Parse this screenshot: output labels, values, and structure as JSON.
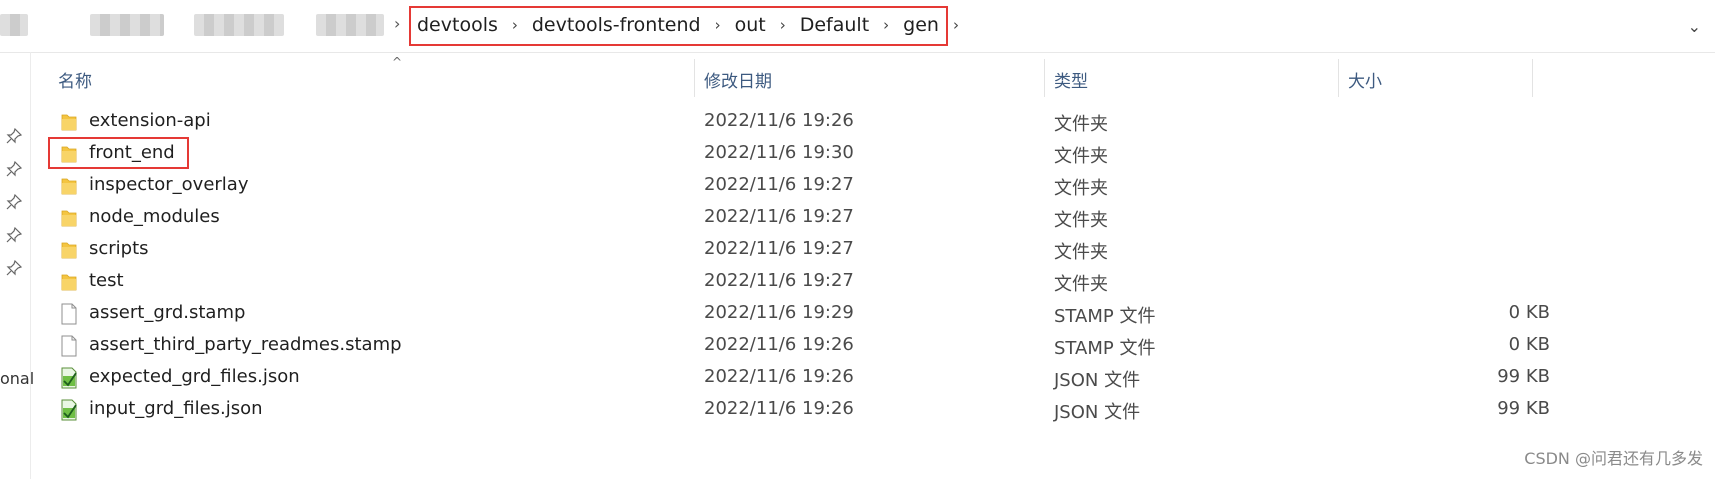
{
  "breadcrumb": {
    "items": [
      "devtools",
      "devtools-frontend",
      "out",
      "Default",
      "gen"
    ]
  },
  "columns": {
    "name": "名称",
    "date": "修改日期",
    "type": "类型",
    "size": "大小"
  },
  "nav_label": "onal",
  "files": [
    {
      "name": "extension-api",
      "date": "2022/11/6 19:26",
      "type": "文件夹",
      "size": "",
      "icon": "folder-icon"
    },
    {
      "name": "front_end",
      "date": "2022/11/6 19:30",
      "type": "文件夹",
      "size": "",
      "icon": "folder-icon"
    },
    {
      "name": "inspector_overlay",
      "date": "2022/11/6 19:27",
      "type": "文件夹",
      "size": "",
      "icon": "folder-icon"
    },
    {
      "name": "node_modules",
      "date": "2022/11/6 19:27",
      "type": "文件夹",
      "size": "",
      "icon": "folder-icon"
    },
    {
      "name": "scripts",
      "date": "2022/11/6 19:27",
      "type": "文件夹",
      "size": "",
      "icon": "folder-icon"
    },
    {
      "name": "test",
      "date": "2022/11/6 19:27",
      "type": "文件夹",
      "size": "",
      "icon": "folder-icon"
    },
    {
      "name": "assert_grd.stamp",
      "date": "2022/11/6 19:29",
      "type": "STAMP 文件",
      "size": "0 KB",
      "icon": "file-icon"
    },
    {
      "name": "assert_third_party_readmes.stamp",
      "date": "2022/11/6 19:26",
      "type": "STAMP 文件",
      "size": "0 KB",
      "icon": "file-icon"
    },
    {
      "name": "expected_grd_files.json",
      "date": "2022/11/6 19:26",
      "type": "JSON 文件",
      "size": "99 KB",
      "icon": "json-file-icon"
    },
    {
      "name": "input_grd_files.json",
      "date": "2022/11/6 19:26",
      "type": "JSON 文件",
      "size": "99 KB",
      "icon": "json-file-icon"
    }
  ],
  "watermark": "CSDN @问君还有几多发",
  "colors": {
    "highlight": "#e53935",
    "folder": "#f4c542",
    "header_text": "#3d5a80"
  }
}
